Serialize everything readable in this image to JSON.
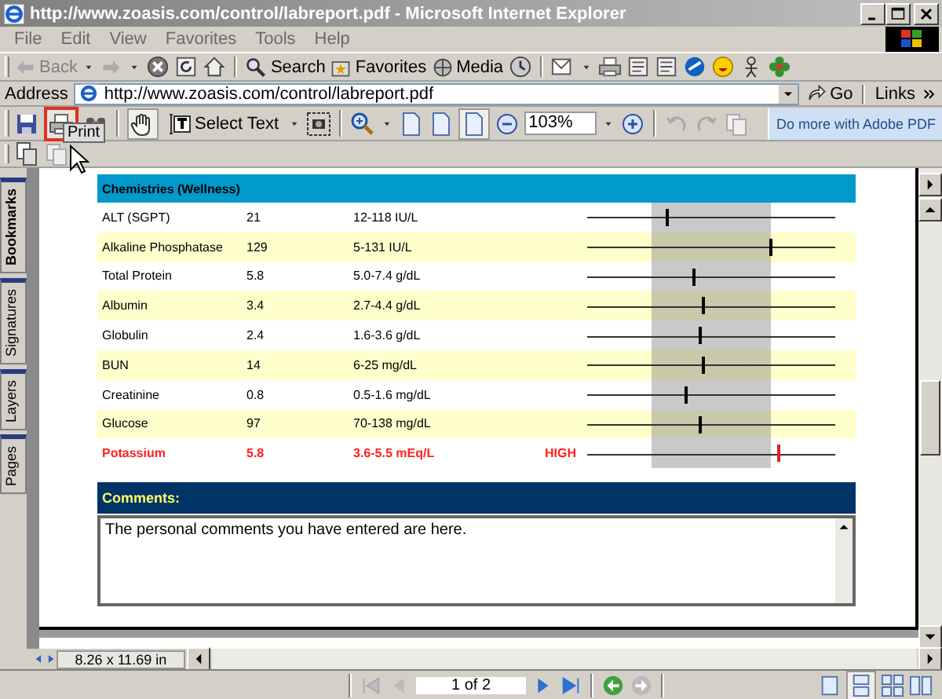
{
  "window": {
    "title": "http://www.zoasis.com/control/labreport.pdf - Microsoft Internet Explorer"
  },
  "menu": [
    "File",
    "Edit",
    "View",
    "Favorites",
    "Tools",
    "Help"
  ],
  "toolbar": {
    "back": "Back",
    "search": "Search",
    "favorites": "Favorites",
    "media": "Media"
  },
  "address_bar": {
    "label": "Address",
    "value": "http://www.zoasis.com/control/labreport.pdf",
    "go": "Go",
    "links": "Links"
  },
  "reader_toolbar": {
    "tooltip": "Print",
    "select_tool": "Select Text",
    "zoom": "103%",
    "promo": "Do more with Adobe PDF"
  },
  "side_tabs": [
    "Bookmarks",
    "Signatures",
    "Layers",
    "Pages"
  ],
  "report": {
    "section": "Chemistries (Wellness)",
    "rows": [
      {
        "name": "ALT (SGPT)",
        "result": "21",
        "range": "12-118 IU/L",
        "level": 0.32,
        "abnormal": false
      },
      {
        "name": "Alkaline Phosphatase",
        "result": "129",
        "range": "5-131 IU/L",
        "level": 0.74,
        "abnormal": false
      },
      {
        "name": "Total Protein",
        "result": "5.8",
        "range": "5.0-7.4 g/dL",
        "level": 0.43,
        "abnormal": false
      },
      {
        "name": "Albumin",
        "result": "3.4",
        "range": "2.7-4.4 g/dL",
        "level": 0.47,
        "abnormal": false
      },
      {
        "name": "Globulin",
        "result": "2.4",
        "range": "1.6-3.6 g/dL",
        "level": 0.455,
        "abnormal": false
      },
      {
        "name": "BUN",
        "result": "14",
        "range": "6-25 mg/dL",
        "level": 0.47,
        "abnormal": false
      },
      {
        "name": "Creatinine",
        "result": "0.8",
        "range": "0.5-1.6 mg/dL",
        "level": 0.4,
        "abnormal": false
      },
      {
        "name": "Glucose",
        "result": "97",
        "range": "70-138 mg/dL",
        "level": 0.455,
        "abnormal": false
      },
      {
        "name": "Potassium",
        "result": "5.8",
        "range": "3.6-5.5 mEq/L",
        "flag": "HIGH",
        "level": 0.77,
        "abnormal": true
      }
    ]
  },
  "comments": {
    "title": "Comments:",
    "text": "The personal comments you have entered are here."
  },
  "status": {
    "page_size": "8.26 x 11.69 in",
    "page": "1 of 2"
  }
}
